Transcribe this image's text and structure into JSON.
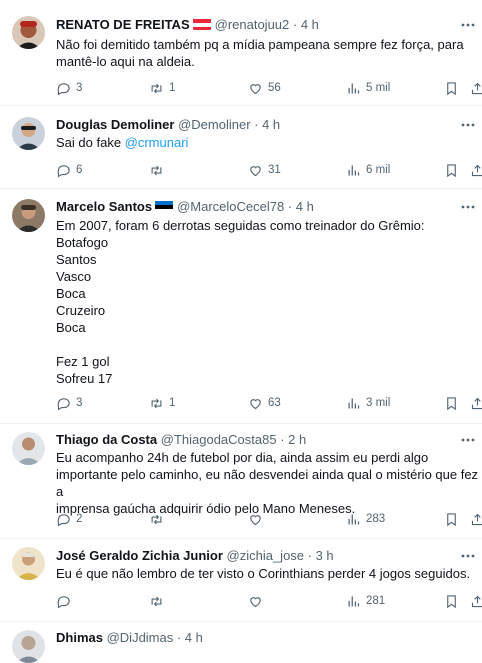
{
  "tweets": [
    {
      "name": "RENATO DE FREITAS",
      "handle": "@renatojuu2 · 4 h",
      "text": "Não foi demitido também pq a mídia pampeana sempre fez força, para\nmantê-lo aqui na aldeia.",
      "replies": "3",
      "retweets": "1",
      "likes": "56",
      "views": "5 mil",
      "flag": "austria",
      "avatar_color": "#b5533a"
    },
    {
      "name": "Douglas Demoliner",
      "handle": "@Demoliner · 4 h",
      "text": "Sai do fake ",
      "mention": "@crmunari",
      "replies": "6",
      "retweets": "",
      "likes": "31",
      "views": "6 mil",
      "avatar_color": "#3b4a5a"
    },
    {
      "name": "Marcelo Santos",
      "handle": "@MarceloCecel78 · 4 h",
      "text": "Em 2007, foram 6 derrotas seguidas como treinador do Grêmio:\nBotafogo\nSantos\nVasco\nBoca\nCruzeiro\nBoca\n\nFez 1 gol\nSofreu 17",
      "replies": "3",
      "retweets": "1",
      "likes": "63",
      "views": "3 mil",
      "flag": "estonia",
      "avatar_color": "#5a4a3a"
    },
    {
      "name": "Thiago da Costa",
      "handle": "@ThiagodaCosta85 · 2 h",
      "text": "Eu acompanho 24h de futebol por dia, ainda assim eu perdi algo\nimportante pelo caminho, eu não desvendei ainda qual o mistério que fez a\nimprensa gaúcha adquirir ódio pelo Mano Meneses.",
      "replies": "2",
      "retweets": "",
      "likes": "",
      "views": "283",
      "avatar_color": "#8a9aa8"
    },
    {
      "name": "José Geraldo Zichia Junior",
      "handle": "@zichia_jose · 3 h",
      "text": "Eu é que não lembro de ter visto o Corinthians perder 4 jogos seguidos.",
      "replies": "",
      "retweets": "",
      "likes": "",
      "views": "281",
      "avatar_color": "#c9a96e"
    },
    {
      "name": "Dhimas",
      "handle": "@DiJdimas · 4 h",
      "avatar_color": "#9aa7b2"
    }
  ]
}
